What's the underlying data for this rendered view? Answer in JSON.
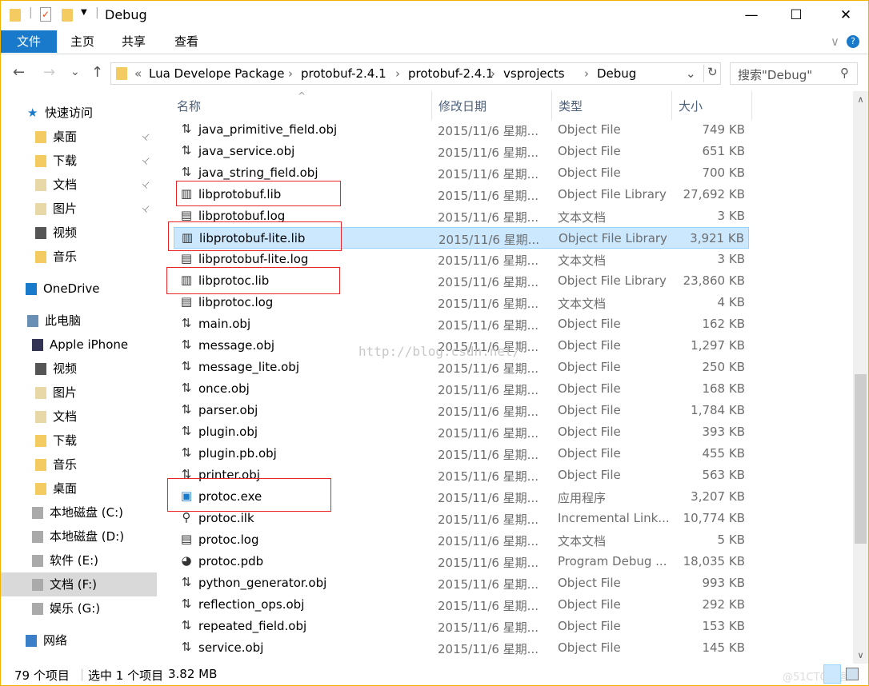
{
  "window": {
    "title": "Debug",
    "minimize": "—",
    "maximize": "☐",
    "close": "✕"
  },
  "ribbon": {
    "tabs": [
      "文件",
      "主页",
      "共享",
      "查看"
    ],
    "expand": "∨",
    "help": "?"
  },
  "nav": {
    "back": "←",
    "forward": "→",
    "recent": "⌄",
    "up": "↑",
    "refresh": "↻",
    "breadcrumb": [
      "«",
      "Lua Develope Package",
      "›",
      "protobuf-2.4.1",
      "›",
      "protobuf-2.4.1",
      "›",
      "vsprojects",
      "›",
      "Debug"
    ],
    "dropdown": "⌄",
    "search_placeholder": "搜索\"Debug\"",
    "search_icon": "⚲"
  },
  "sidebar": {
    "items": [
      {
        "label": "快速访问",
        "icon": "star-icon",
        "color": "#1979ca",
        "pinned": false
      },
      {
        "label": "桌面",
        "icon": "folder-icon",
        "pinned": true
      },
      {
        "label": "下载",
        "icon": "download-folder-icon",
        "pinned": true
      },
      {
        "label": "文档",
        "icon": "documents-icon",
        "pinned": true
      },
      {
        "label": "图片",
        "icon": "pictures-icon",
        "pinned": true
      },
      {
        "label": "视频",
        "icon": "videos-icon",
        "pinned": false
      },
      {
        "label": "音乐",
        "icon": "music-icon",
        "pinned": false
      },
      {
        "label": "OneDrive",
        "icon": "cloud-icon",
        "pinned": false
      },
      {
        "label": "此电脑",
        "icon": "computer-icon",
        "pinned": false
      },
      {
        "label": "Apple iPhone",
        "icon": "phone-icon",
        "pinned": false
      },
      {
        "label": "视频",
        "icon": "videos-icon",
        "pinned": false
      },
      {
        "label": "图片",
        "icon": "pictures-icon",
        "pinned": false
      },
      {
        "label": "文档",
        "icon": "documents-icon",
        "pinned": false
      },
      {
        "label": "下载",
        "icon": "download-folder-icon",
        "pinned": false
      },
      {
        "label": "音乐",
        "icon": "music-icon",
        "pinned": false
      },
      {
        "label": "桌面",
        "icon": "folder-icon",
        "pinned": false
      },
      {
        "label": "本地磁盘 (C:)",
        "icon": "drive-icon",
        "pinned": false
      },
      {
        "label": "本地磁盘 (D:)",
        "icon": "drive-icon",
        "pinned": false
      },
      {
        "label": "软件 (E:)",
        "icon": "drive-icon",
        "pinned": false
      },
      {
        "label": "文档 (F:)",
        "icon": "drive-icon",
        "pinned": false,
        "selected": true
      },
      {
        "label": "娱乐 (G:)",
        "icon": "drive-icon",
        "pinned": false
      },
      {
        "label": "网络",
        "icon": "network-icon",
        "pinned": false
      }
    ],
    "pin_glyph": "📌"
  },
  "columns": {
    "name": "名称",
    "date": "修改日期",
    "type": "类型",
    "size": "大小",
    "sort": "^"
  },
  "files": [
    {
      "name": "java_primitive_field.obj",
      "date": "2015/11/6 星期...",
      "type": "Object File",
      "size": "749 KB",
      "icon": "obj"
    },
    {
      "name": "java_service.obj",
      "date": "2015/11/6 星期...",
      "type": "Object File",
      "size": "651 KB",
      "icon": "obj"
    },
    {
      "name": "java_string_field.obj",
      "date": "2015/11/6 星期...",
      "type": "Object File",
      "size": "700 KB",
      "icon": "obj"
    },
    {
      "name": "libprotobuf.lib",
      "date": "2015/11/6 星期...",
      "type": "Object File Library",
      "size": "27,692 KB",
      "icon": "lib",
      "highlighted": true
    },
    {
      "name": "libprotobuf.log",
      "date": "2015/11/6 星期...",
      "type": "文本文档",
      "size": "3 KB",
      "icon": "txt"
    },
    {
      "name": "libprotobuf-lite.lib",
      "date": "2015/11/6 星期...",
      "type": "Object File Library",
      "size": "3,921 KB",
      "icon": "lib",
      "selected": true,
      "highlighted": true
    },
    {
      "name": "libprotobuf-lite.log",
      "date": "2015/11/6 星期...",
      "type": "文本文档",
      "size": "3 KB",
      "icon": "txt"
    },
    {
      "name": "libprotoc.lib",
      "date": "2015/11/6 星期...",
      "type": "Object File Library",
      "size": "23,860 KB",
      "icon": "lib",
      "highlighted": true
    },
    {
      "name": "libprotoc.log",
      "date": "2015/11/6 星期...",
      "type": "文本文档",
      "size": "4 KB",
      "icon": "txt"
    },
    {
      "name": "main.obj",
      "date": "2015/11/6 星期...",
      "type": "Object File",
      "size": "162 KB",
      "icon": "obj"
    },
    {
      "name": "message.obj",
      "date": "2015/11/6 星期...",
      "type": "Object File",
      "size": "1,297 KB",
      "icon": "obj"
    },
    {
      "name": "message_lite.obj",
      "date": "2015/11/6 星期...",
      "type": "Object File",
      "size": "250 KB",
      "icon": "obj"
    },
    {
      "name": "once.obj",
      "date": "2015/11/6 星期...",
      "type": "Object File",
      "size": "168 KB",
      "icon": "obj"
    },
    {
      "name": "parser.obj",
      "date": "2015/11/6 星期...",
      "type": "Object File",
      "size": "1,784 KB",
      "icon": "obj"
    },
    {
      "name": "plugin.obj",
      "date": "2015/11/6 星期...",
      "type": "Object File",
      "size": "393 KB",
      "icon": "obj"
    },
    {
      "name": "plugin.pb.obj",
      "date": "2015/11/6 星期...",
      "type": "Object File",
      "size": "455 KB",
      "icon": "obj"
    },
    {
      "name": "printer.obj",
      "date": "2015/11/6 星期...",
      "type": "Object File",
      "size": "563 KB",
      "icon": "obj"
    },
    {
      "name": "protoc.exe",
      "date": "2015/11/6 星期...",
      "type": "应用程序",
      "size": "3,207 KB",
      "icon": "exe",
      "highlighted": true
    },
    {
      "name": "protoc.ilk",
      "date": "2015/11/6 星期...",
      "type": "Incremental Link...",
      "size": "10,774 KB",
      "icon": "ilk"
    },
    {
      "name": "protoc.log",
      "date": "2015/11/6 星期...",
      "type": "文本文档",
      "size": "5 KB",
      "icon": "txt"
    },
    {
      "name": "protoc.pdb",
      "date": "2015/11/6 星期...",
      "type": "Program Debug ...",
      "size": "18,035 KB",
      "icon": "pdb"
    },
    {
      "name": "python_generator.obj",
      "date": "2015/11/6 星期...",
      "type": "Object File",
      "size": "993 KB",
      "icon": "obj"
    },
    {
      "name": "reflection_ops.obj",
      "date": "2015/11/6 星期...",
      "type": "Object File",
      "size": "292 KB",
      "icon": "obj"
    },
    {
      "name": "repeated_field.obj",
      "date": "2015/11/6 星期...",
      "type": "Object File",
      "size": "153 KB",
      "icon": "obj"
    },
    {
      "name": "service.obj",
      "date": "2015/11/6 星期...",
      "type": "Object File",
      "size": "145 KB",
      "icon": "obj"
    }
  ],
  "status": {
    "count": "79 个项目",
    "selection": "选中 1 个项目",
    "size": "3.82 MB",
    "watermark_corner": "@51CTO博客"
  },
  "watermark": "http://blog.csdn.net/",
  "colors": {
    "accent": "#1979ca",
    "selection": "#cce8ff",
    "annotation": "#e8262a",
    "frame": "#f0b400"
  },
  "scroll": {
    "position_fraction": 0.55
  }
}
